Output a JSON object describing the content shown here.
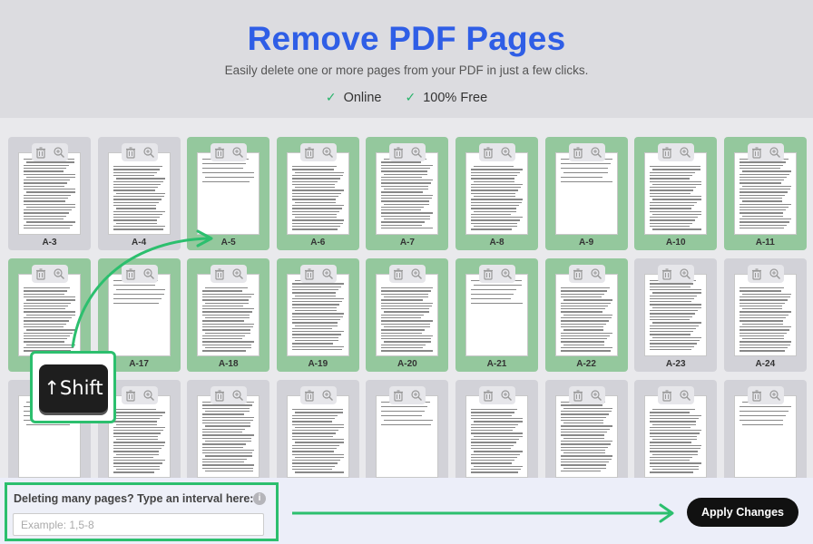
{
  "header": {
    "title": "Remove PDF Pages",
    "subtitle": "Easily delete one or more pages from your PDF in just a few clicks.",
    "features": [
      "Online",
      "100% Free"
    ]
  },
  "pages": [
    {
      "label": "A-3",
      "selected": false
    },
    {
      "label": "A-4",
      "selected": false
    },
    {
      "label": "A-5",
      "selected": true
    },
    {
      "label": "A-6",
      "selected": true
    },
    {
      "label": "A-7",
      "selected": true
    },
    {
      "label": "A-8",
      "selected": true
    },
    {
      "label": "A-9",
      "selected": true
    },
    {
      "label": "A-10",
      "selected": true
    },
    {
      "label": "A-11",
      "selected": true
    },
    {
      "label": "",
      "selected": true
    },
    {
      "label": "A-17",
      "selected": true
    },
    {
      "label": "A-18",
      "selected": true
    },
    {
      "label": "A-19",
      "selected": true
    },
    {
      "label": "A-20",
      "selected": true
    },
    {
      "label": "A-21",
      "selected": true
    },
    {
      "label": "A-22",
      "selected": true
    },
    {
      "label": "A-23",
      "selected": false
    },
    {
      "label": "A-24",
      "selected": false
    },
    {
      "label": "",
      "selected": false
    },
    {
      "label": "",
      "selected": false
    },
    {
      "label": "",
      "selected": false
    },
    {
      "label": "",
      "selected": false
    },
    {
      "label": "",
      "selected": false
    },
    {
      "label": "",
      "selected": false
    },
    {
      "label": "",
      "selected": false
    },
    {
      "label": "",
      "selected": false
    },
    {
      "label": "",
      "selected": false
    }
  ],
  "interval": {
    "label": "Deleting many pages? Type an interval here:",
    "info_icon": "i",
    "placeholder": "Example: 1,5-8"
  },
  "apply_button": "Apply Changes",
  "shift_key": "↑Shift",
  "colors": {
    "title_blue": "#2f5ee6",
    "selected_green": "#94c89d",
    "highlight_green": "#2cbf6e",
    "check_green": "#27b36a"
  }
}
